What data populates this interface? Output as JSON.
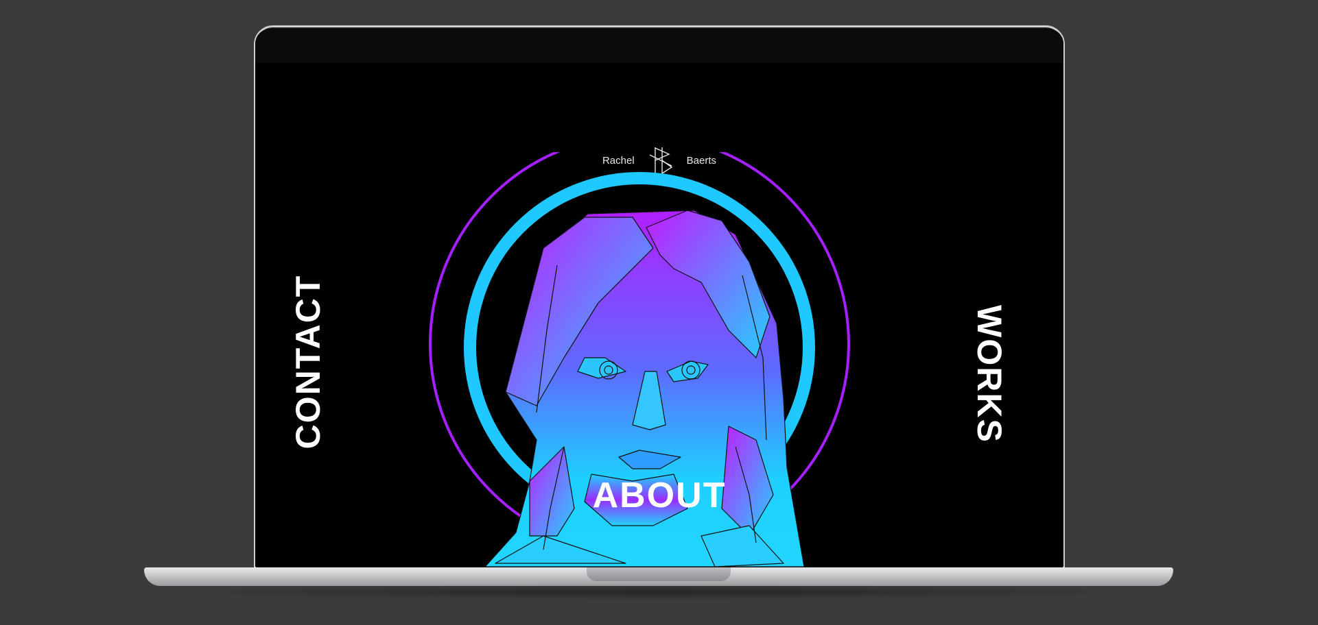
{
  "site": {
    "brand": {
      "first_name": "Rachel",
      "last_name": "Baerts",
      "logo_icon": "rb-monogram-icon"
    },
    "nav": {
      "contact": "CONTACT",
      "works": "WORKS",
      "about": "ABOUT"
    },
    "hero_image": "polygonal-portrait-illustration"
  },
  "colors": {
    "background": "#000000",
    "purple": "#b020ff",
    "cyan": "#1fd0ff",
    "frame": "#3b3b3b"
  }
}
